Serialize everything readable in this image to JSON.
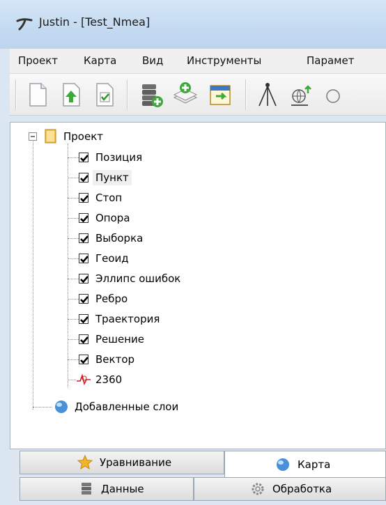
{
  "window": {
    "title": "Justin - [Test_Nmea]",
    "title_icon": "justin-logo-icon"
  },
  "menu": {
    "items": [
      "Проект",
      "Карта",
      "Вид",
      "Инструменты",
      "Парамет"
    ]
  },
  "toolbar": {
    "buttons": [
      "new-document-icon",
      "open-document-icon",
      "save-document-icon",
      "database-add-icon",
      "layers-add-icon",
      "calendar-import-icon",
      "tripod-icon",
      "globe-updown-icon"
    ]
  },
  "tree": {
    "root_label": "Проект",
    "items": [
      "Позиция",
      "Пункт",
      "Стоп",
      "Опора",
      "Выборка",
      "Геоид",
      "Эллипс ошибок",
      "Ребро",
      "Траектория",
      "Решение",
      "Вектор"
    ],
    "marker_label": "2360",
    "added_layers_label": "Добавленные слои"
  },
  "tabs": {
    "top": [
      "Уравнивание",
      "Карта"
    ],
    "bottom": [
      "Данные",
      "Обработка"
    ],
    "active": "Карта"
  }
}
